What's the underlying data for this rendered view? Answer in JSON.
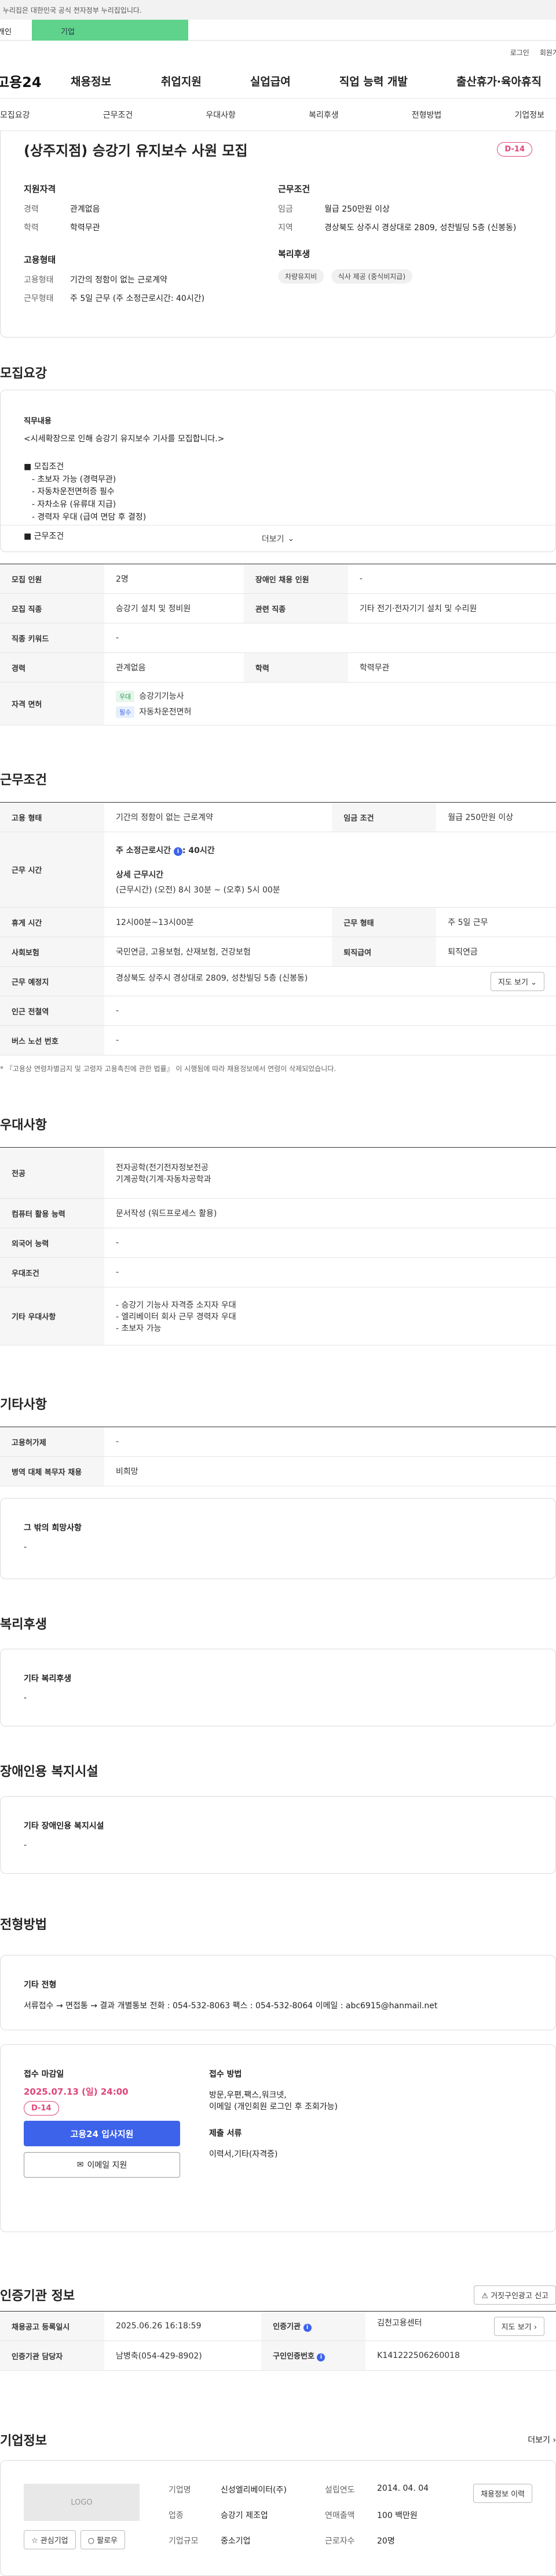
{
  "banner": {
    "text": "이 누리집은 대한민국 공식 전자정부 누리집입니다."
  },
  "top_tabs": {
    "first": "개인",
    "second": "기업"
  },
  "util": {
    "login": "로그인",
    "signup": "회원가입"
  },
  "gnb": {
    "logo": "고용24",
    "items": [
      "채용정보",
      "취업지원",
      "실업급여",
      "직업 능력 개발",
      "출산휴가·육아휴직"
    ]
  },
  "subnav": {
    "items": [
      "모집요강",
      "근무조건",
      "우대사항",
      "복리후생",
      "전형방법",
      "기업정보"
    ]
  },
  "summary": {
    "title": "(상주지점) 승강기 유지보수 사원 모집",
    "dday": "D-14",
    "qual_title": "지원자격",
    "qual": [
      {
        "k": "경력",
        "v": "관계없음"
      },
      {
        "k": "학력",
        "v": "학력무관"
      }
    ],
    "emp_title": "고용형태",
    "emp": [
      {
        "k": "고용형태",
        "v": "기간의 정함이 없는 근로계약"
      },
      {
        "k": "근무형태",
        "v": "주 5일 근무 (주 소정근로시간: 40시간)"
      }
    ],
    "cond_title": "근무조건",
    "cond": [
      {
        "k": "임금",
        "v": "월급 250만원 이상"
      },
      {
        "k": "지역",
        "v": "경상북도 상주시 경상대로 2809, 성찬빌딩 5층 (신봉동)"
      }
    ],
    "welfare_title": "복리후생",
    "welfare_chips": [
      "차량유지비",
      "식사 제공 (중식비지급)"
    ]
  },
  "recruit": {
    "section_title": "모집요강",
    "duty_label": "직무내용",
    "duty_text": "<시세확장으로 인해 승강기 유지보수 기사를 모집합니다.>",
    "cond_head": "■ 모집조건",
    "cond_lines": [
      "- 초보자 가능 (경력무관)",
      "- 자동차운전면허증 필수",
      "- 자차소유 (유류대 지급)",
      "- 경력자 우대 (급여 면담 후 결정)"
    ],
    "work_head": "■ 근무조건",
    "more": "더보기"
  },
  "recruit_table": {
    "rows": [
      [
        "모집 인원",
        "2명",
        "장애인 채용 인원",
        "-"
      ],
      [
        "모집 직종",
        "승강기 설치 및 정비원",
        "관련 직종",
        "기타 전기·전자기기 설치 및 수리원"
      ],
      [
        "직종 키워드",
        "-",
        "",
        ""
      ],
      [
        "경력",
        "관계없음",
        "학력",
        "학력무관"
      ]
    ],
    "license_label": "자격 면허",
    "licenses": [
      {
        "tag": "우대",
        "name": "승강기기능사"
      },
      {
        "tag": "필수",
        "name": "자동차운전면허"
      }
    ]
  },
  "work": {
    "section_title": "근무조건",
    "emp_type_label": "고용 형태",
    "emp_type": "기간의 정함이 없는 근로계약",
    "wage_label": "임금 조건",
    "wage": "월급 250만원 이상",
    "hours_label": "근무 시간",
    "hours_week": "주 소정근로시간",
    "hours_week_val": ": 40시간",
    "hours_detail_title": "상세 근무시간",
    "hours_detail": "(근무시간) (오전) 8시 30분 ~ (오후) 5시 00분",
    "rest_label": "휴게 시간",
    "rest": "12시00분~13시00분",
    "form_label": "근무 형태",
    "form": "주 5일 근무",
    "ins_label": "사회보험",
    "ins": "국민연금, 고용보험, 산재보험, 건강보험",
    "sev_label": "퇴직급여",
    "sev": "퇴직연금",
    "place_label": "근무 예정지",
    "place": "경상북도 상주시 경상대로 2809, 성찬빌딩 5층 (신봉동)",
    "map_btn": "지도 보기",
    "station_label": "인근 전철역",
    "station": "-",
    "bus_label": "버스 노선 번호",
    "bus": "-",
    "note": "* 『고용상 연령차별금지 및 고령자 고용촉진에 관한 법률』 이 시행됨에 따라 채용정보에서 연령이 삭제되었습니다."
  },
  "pref": {
    "section_title": "우대사항",
    "major_label": "전공",
    "major": [
      "전자공학(전기전자정보전공",
      "기계공학(기계·자동차공학과"
    ],
    "pc_label": "컴퓨터 활용 능력",
    "pc": "문서작성 (워드프로세스 활용)",
    "lang_label": "외국어 능력",
    "lang": "-",
    "cond_label": "우대조건",
    "cond": "-",
    "etc_label": "기타 우대사항",
    "etc": [
      "- 승강기 기능사 자격증 소지자 우대",
      "- 엘리베이터 회사 근무 경력자 우대",
      "- 초보자 가능"
    ]
  },
  "other": {
    "section_title": "기타사항",
    "ins_label": "고용허가제",
    "ins": "-",
    "mil_label": "병역 대체 복무자 채용",
    "mil": "비희망",
    "hope_label": "그 밖의 희망사항",
    "hope": "-"
  },
  "welfare": {
    "section_title": "복리후생",
    "label": "기타 복리후생",
    "value": "-"
  },
  "disabled": {
    "section_title": "장애인용 복지시설",
    "label": "기타 장애인용 복지시설",
    "value": "-"
  },
  "screening": {
    "section_title": "전형방법",
    "etc_label": "기타 전형",
    "etc_text": "서류접수 → 면접통 → 결과 개별통보 전화 : 054-532-8063 팩스 : 054-532-8064 이메일 : abc6915@hanmail.net",
    "deadline_label": "접수 마감일",
    "deadline": "2025.07.13 (일) 24:00",
    "dday": "D-14",
    "apply_btn": "고용24 입사지원",
    "email_btn": "이메일 지원",
    "method_label": "접수 방법",
    "method_lines": [
      "방문,우편,팩스,워크넷,",
      "이메일 (개인회원 로그인 후 조회가능)"
    ],
    "docs_label": "제출 서류",
    "docs": "이력서,기타(자격증)"
  },
  "cert": {
    "section_title": "인증기관 정보",
    "report_btn": "거짓구인광고 신고",
    "rows": [
      [
        "채용공고 등록일시",
        "2025.06.26 16:18:59",
        "인증기관",
        "김천고용센터"
      ],
      [
        "인증기관 담당자",
        "남병축(054-429-8902)",
        "구인인증번호",
        "K141222506260018"
      ]
    ],
    "map_btn": "지도 보기"
  },
  "company": {
    "section_title": "기업정보",
    "more": "더보기",
    "logo": "LOGO",
    "fav_btn": "관심기업",
    "follow_btn": "팔로우",
    "fields": [
      [
        "기업명",
        "신성엘리베이터(주)",
        "설립연도",
        "2014. 04. 04"
      ],
      [
        "업종",
        "승강기 제조업",
        "연매출액",
        "100 백만원"
      ],
      [
        "기업규모",
        "중소기업",
        "근로자수",
        "20명"
      ]
    ],
    "history_btn": "채용정보 이력"
  }
}
